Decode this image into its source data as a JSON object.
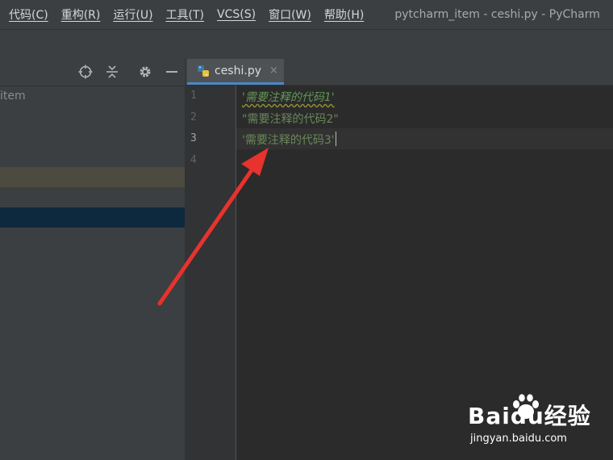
{
  "menu": {
    "items": [
      "代码(C)",
      "重构(R)",
      "运行(U)",
      "工具(T)",
      "VCS(S)",
      "窗口(W)",
      "帮助(H)"
    ],
    "window_title": "pytcharm_item - ceshi.py - PyCharm"
  },
  "project_panel": {
    "tree_label": "item",
    "icons": [
      "crosshair-icon",
      "collapse-icon",
      "gear-icon",
      "minimize-icon"
    ]
  },
  "editor": {
    "tab": {
      "label": "ceshi.py",
      "close": "×",
      "icon": "python-file-icon"
    },
    "line_numbers": [
      "1",
      "2",
      "3",
      "4"
    ],
    "lines": [
      "'需要注释的代码1'",
      "\"需要注释的代码2\"",
      "'需要注释的代码3'",
      ""
    ],
    "current_line": 3
  },
  "annotation": {
    "shape": "red-arrow",
    "color": "#e8322d"
  },
  "watermark": {
    "logo": "Baidu经验",
    "url": "jingyan.baidu.com"
  },
  "colors": {
    "ide_background": "#2b2b2b",
    "panel_background": "#3c3f41",
    "string_green": "#6a8759",
    "tab_underline": "#4a88c7"
  }
}
